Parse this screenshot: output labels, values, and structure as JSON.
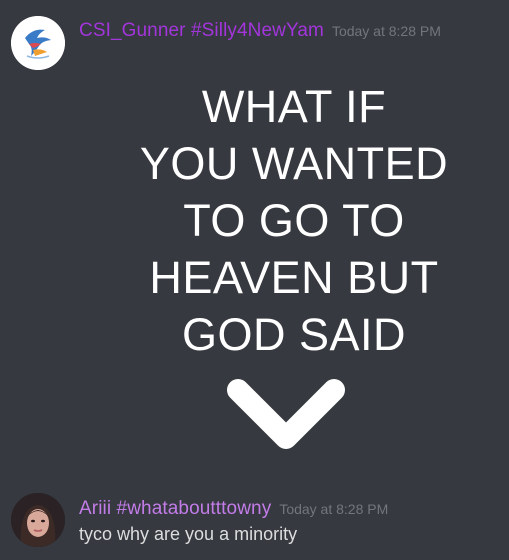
{
  "messages": [
    {
      "username": "CSI_Gunner #Silly4NewYam",
      "timestamp": "Today at 8:28 PM",
      "image_text_lines": [
        "WHAT IF",
        "YOU WANTED",
        "TO GO TO",
        "HEAVEN BUT",
        "GOD SAID"
      ],
      "image_icon": "chevron-down-icon"
    },
    {
      "username": "Ariii #whataboutttowny",
      "timestamp": "Today at 8:28 PM",
      "text": "tyco why are you a minority"
    }
  ],
  "colors": {
    "background": "#36393f",
    "username_1": "#a335dc",
    "username_2": "#c27ce8",
    "timestamp": "#72767d",
    "message_text": "#dcddde"
  }
}
